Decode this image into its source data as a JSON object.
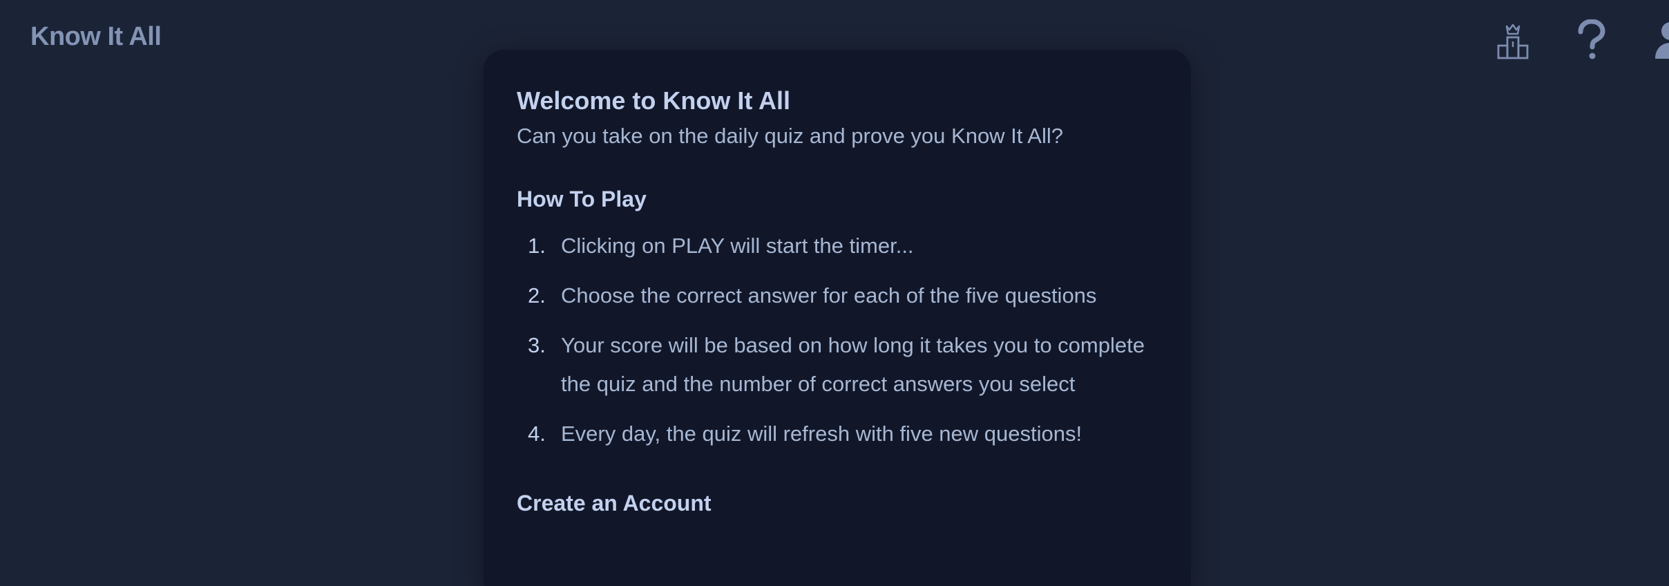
{
  "header": {
    "brand": "Know It All",
    "icons": [
      {
        "name": "leaderboard-icon"
      },
      {
        "name": "help-icon"
      },
      {
        "name": "account-icon"
      }
    ]
  },
  "card": {
    "title": "Welcome to Know It All",
    "subtitle": "Can you take on the daily quiz and prove you Know It All?",
    "how_to_play": {
      "heading": "How To Play",
      "steps": [
        {
          "num": "1.",
          "text": "Clicking on PLAY will start the timer..."
        },
        {
          "num": "2.",
          "text": "Choose the correct answer for each of the five questions"
        },
        {
          "num": "3.",
          "text": "Your score will be based on how long it takes you to complete the quiz and the number of correct answers you select"
        },
        {
          "num": "4.",
          "text": "Every day, the quiz will refresh with five new questions!"
        }
      ]
    },
    "create_account": {
      "heading": "Create an Account"
    }
  },
  "colors": {
    "background": "#1b2336",
    "card": "#111729",
    "heading": "#c3d1ee",
    "text": "#a7b7d3",
    "brand": "#8394b5",
    "icon": "#7d8db0"
  }
}
